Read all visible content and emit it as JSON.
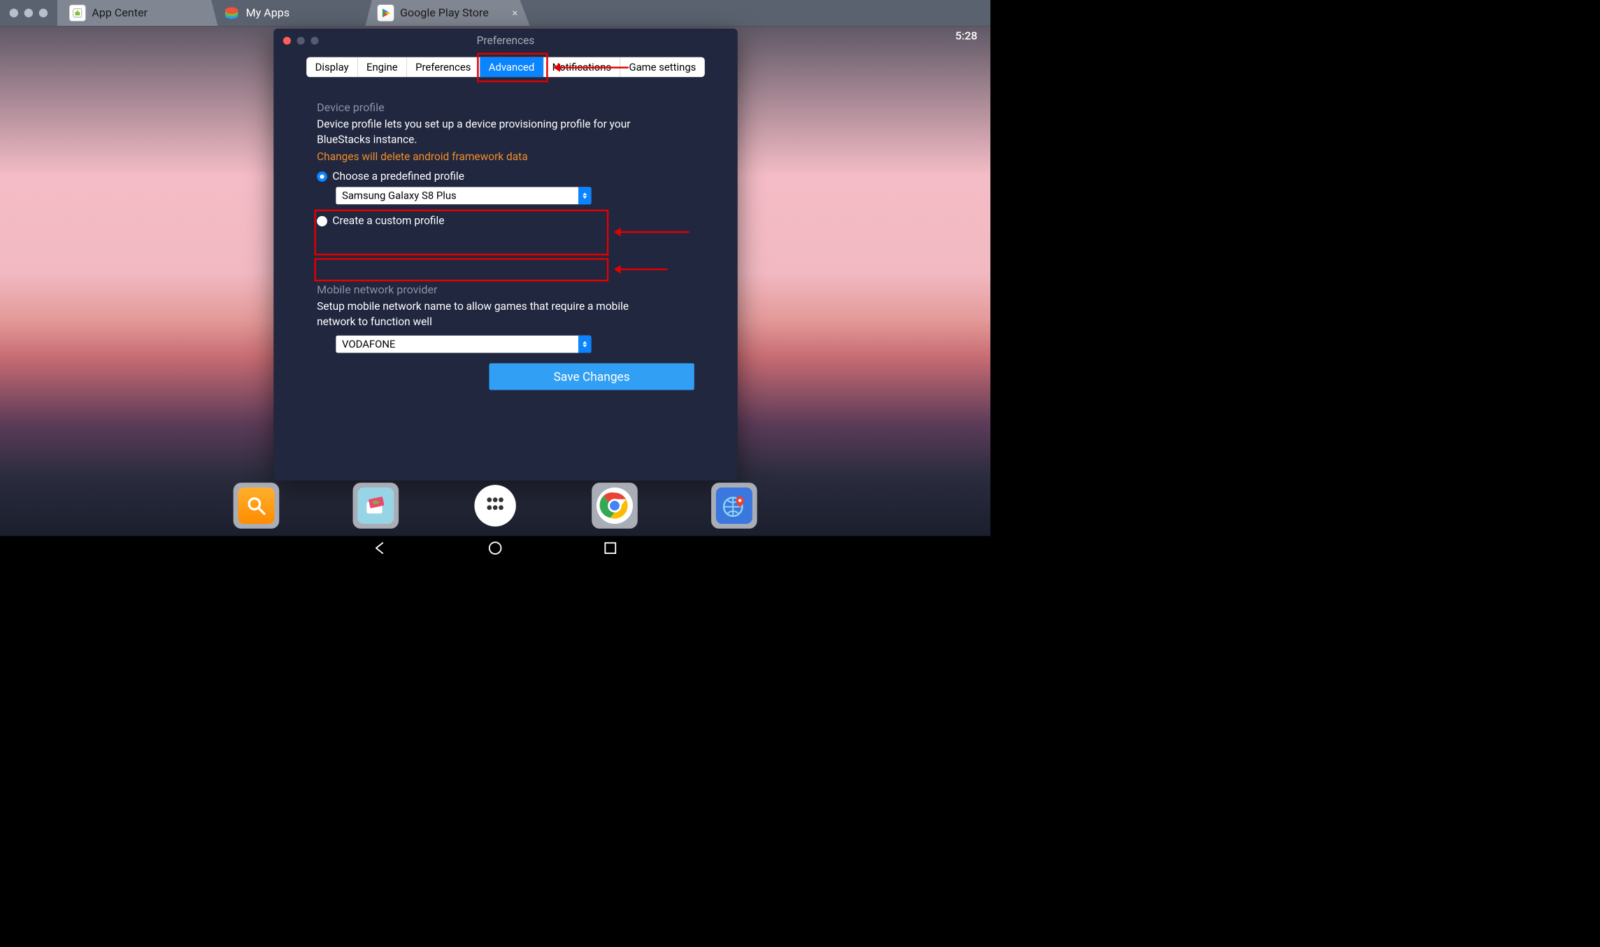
{
  "topbar": {
    "tabs": [
      {
        "label": "App Center",
        "icon": "appcenter-icon"
      },
      {
        "label": "My Apps",
        "icon": "bluestacks-icon"
      },
      {
        "label": "Google Play Store",
        "icon": "play-store-icon"
      }
    ],
    "active_index": 1
  },
  "statusbar": {
    "time": "5:28"
  },
  "prefs": {
    "title": "Preferences",
    "segments": [
      "Display",
      "Engine",
      "Preferences",
      "Advanced",
      "Notifications",
      "Game settings"
    ],
    "active_segment": "Advanced",
    "device_profile": {
      "heading": "Device profile",
      "description": "Device profile lets you set up a device provisioning profile for your BlueStacks instance.",
      "warning": "Changes will delete android framework data",
      "radio_predefined_label": "Choose a predefined profile",
      "predefined_selected": "Samsung Galaxy S8 Plus",
      "radio_custom_label": "Create a custom profile",
      "selected_radio": "predefined"
    },
    "network": {
      "heading": "Mobile network provider",
      "description": "Setup mobile network name to allow games that require a mobile network to function well",
      "selected": "VODAFONE"
    },
    "save_label": "Save Changes"
  },
  "dock": {
    "items": [
      {
        "name": "search",
        "icon": "search-icon"
      },
      {
        "name": "media-manager",
        "icon": "media-icon"
      },
      {
        "name": "app-drawer",
        "icon": "apps-icon"
      },
      {
        "name": "chrome",
        "icon": "chrome-icon"
      },
      {
        "name": "maps",
        "icon": "globe-pin-icon"
      }
    ]
  },
  "androidnav": {
    "back": "back-icon",
    "home": "home-icon",
    "recents": "recents-icon"
  }
}
